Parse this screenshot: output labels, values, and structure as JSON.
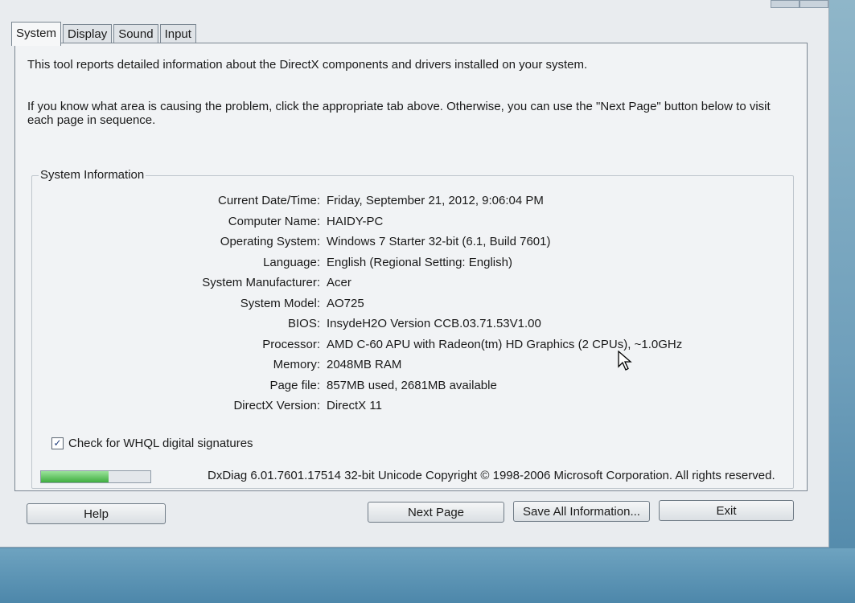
{
  "tabs": [
    {
      "label": "System",
      "active": true
    },
    {
      "label": "Display",
      "active": false
    },
    {
      "label": "Sound",
      "active": false
    },
    {
      "label": "Input",
      "active": false
    }
  ],
  "intro": {
    "line1": "This tool reports detailed information about the DirectX components and drivers installed on your system.",
    "line2": "If you know what area is causing the problem, click the appropriate tab above.  Otherwise, you can use the \"Next Page\" button below to visit each page in sequence."
  },
  "system_info": {
    "title": "System Information",
    "rows": [
      {
        "label": "Current Date/Time:",
        "value": "Friday, September 21, 2012, 9:06:04 PM"
      },
      {
        "label": "Computer Name:",
        "value": "HAIDY-PC"
      },
      {
        "label": "Operating System:",
        "value": "Windows 7 Starter 32-bit (6.1, Build 7601)"
      },
      {
        "label": "Language:",
        "value": "English (Regional Setting: English)"
      },
      {
        "label": "System Manufacturer:",
        "value": "Acer"
      },
      {
        "label": "System Model:",
        "value": "AO725"
      },
      {
        "label": "BIOS:",
        "value": "InsydeH2O Version CCB.03.71.53V1.00"
      },
      {
        "label": "Processor:",
        "value": "AMD C-60 APU with Radeon(tm) HD Graphics (2 CPUs), ~1.0GHz"
      },
      {
        "label": "Memory:",
        "value": "2048MB RAM"
      },
      {
        "label": "Page file:",
        "value": "857MB used, 2681MB available"
      },
      {
        "label": "DirectX Version:",
        "value": "DirectX 11"
      }
    ]
  },
  "whql": {
    "label": "Check for WHQL digital signatures",
    "checked": true
  },
  "progress": {
    "fraction": 0.62,
    "color": "#3fae3f"
  },
  "copyright": "DxDiag 6.01.7601.17514 32-bit Unicode  Copyright © 1998-2006 Microsoft Corporation.  All rights reserved.",
  "buttons": {
    "help": "Help",
    "next_page": "Next Page",
    "save_all": "Save All Information...",
    "exit": "Exit"
  },
  "icons": {
    "cursor": "mouse-pointer-icon"
  }
}
